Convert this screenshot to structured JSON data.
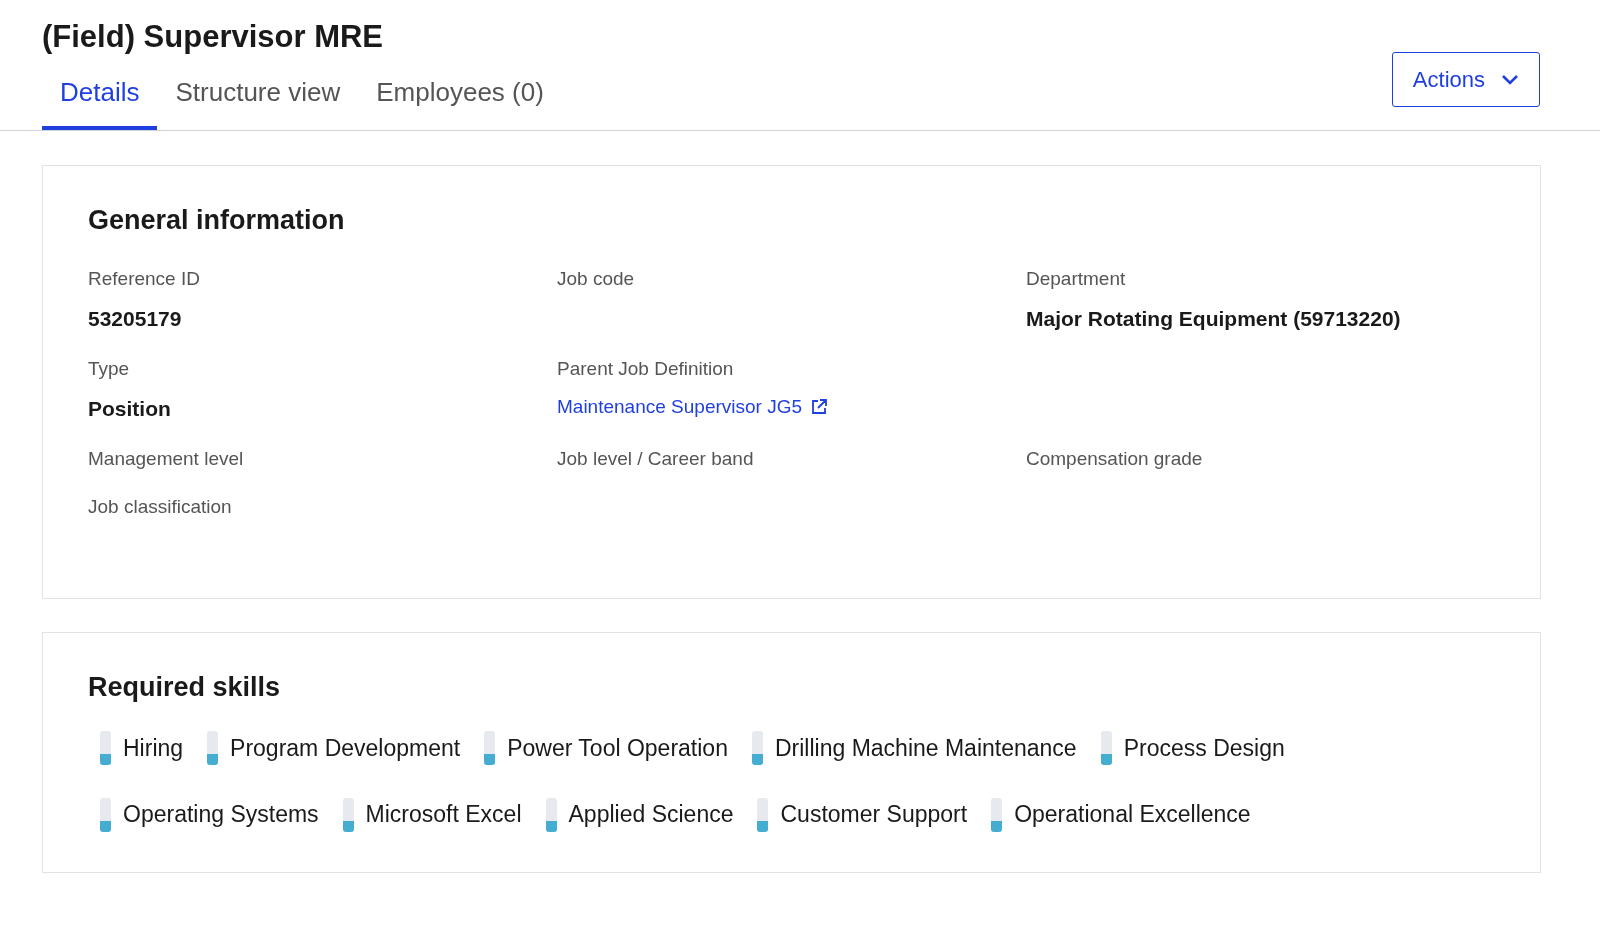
{
  "header": {
    "title": "(Field) Supervisor MRE",
    "actions_button": "Actions"
  },
  "tabs": [
    {
      "label": "Details",
      "selected": true
    },
    {
      "label": "Structure view",
      "selected": false
    },
    {
      "label": "Employees (0)",
      "selected": false
    }
  ],
  "general_information": {
    "title": "General information",
    "fields": [
      {
        "label": "Reference ID",
        "value": "53205179"
      },
      {
        "label": "Job code"
      },
      {
        "label": "Department",
        "value": "Major Rotating Equipment (59713220)"
      },
      {
        "label": "Type",
        "value": "Position"
      },
      {
        "label": "Parent Job Definition",
        "value": "Maintenance Supervisor JG5",
        "kind": "link"
      },
      {
        "kind": "empty"
      },
      {
        "label": "Management level"
      },
      {
        "label": "Job level / Career band"
      },
      {
        "label": "Compensation grade"
      },
      {
        "label": "Job classification"
      }
    ]
  },
  "required_skills": {
    "title": "Required skills",
    "skills": [
      {
        "name": "Hiring",
        "level": 0.33
      },
      {
        "name": "Program Development",
        "level": 0.33
      },
      {
        "name": "Power Tool Operation",
        "level": 0.33
      },
      {
        "name": "Drilling Machine Maintenance",
        "level": 0.33
      },
      {
        "name": "Process Design",
        "level": 0.33
      },
      {
        "name": "Operating Systems",
        "level": 0.33
      },
      {
        "name": "Microsoft Excel",
        "level": 0.33
      },
      {
        "name": "Applied Science",
        "level": 0.33
      },
      {
        "name": "Customer Support",
        "level": 0.33
      },
      {
        "name": "Operational Excellence",
        "level": 0.33
      }
    ]
  }
}
